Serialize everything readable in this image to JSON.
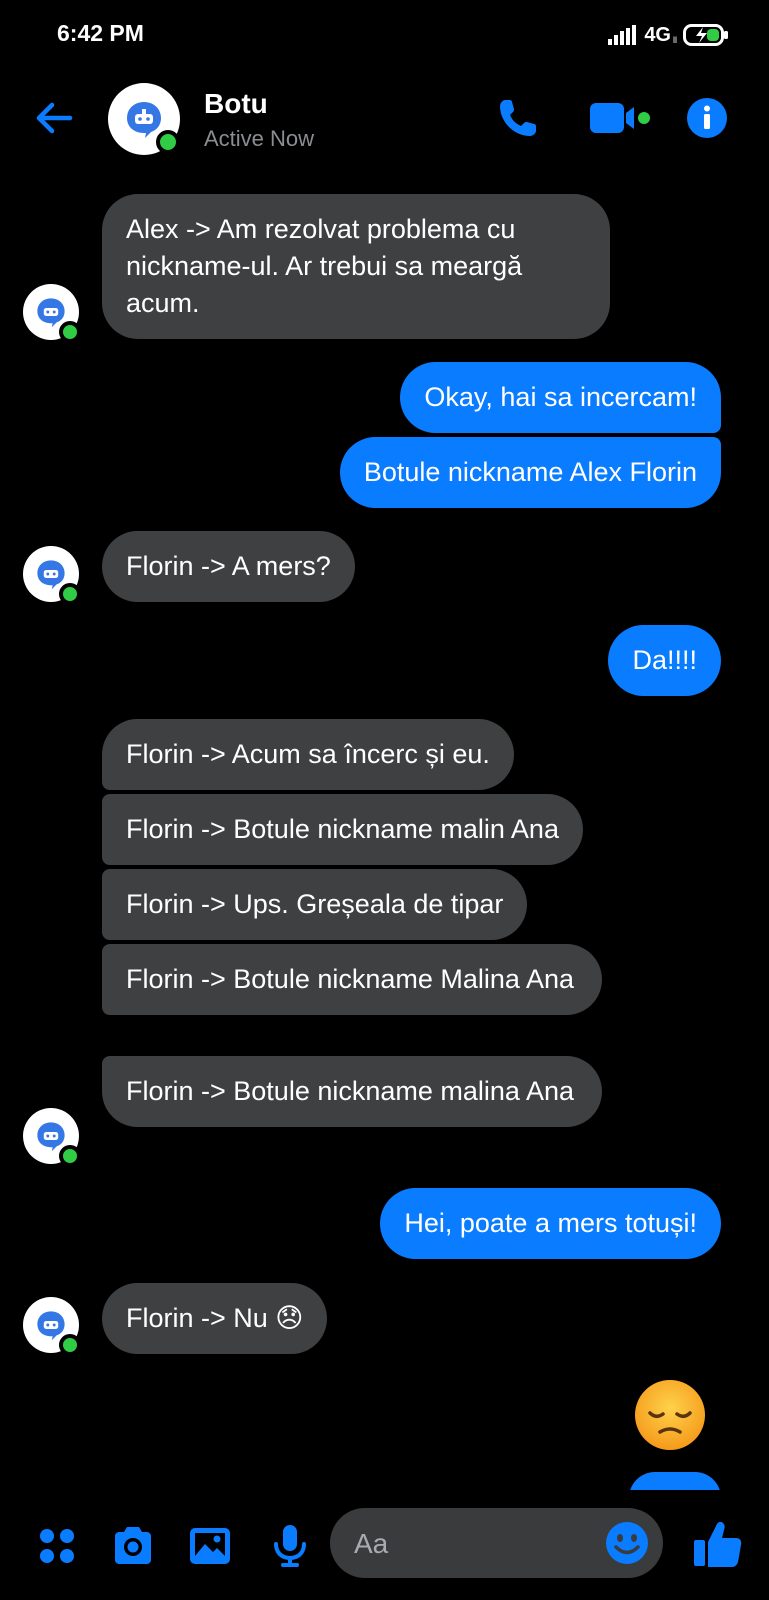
{
  "status_bar": {
    "time": "6:42 PM",
    "network": "4G",
    "network_sub": "ll"
  },
  "header": {
    "name": "Botu",
    "status": "Active Now"
  },
  "messages": [
    {
      "dir": "in",
      "text": "Alex -> Am rezolvat problema cu nickname-ul. Ar trebui sa meargă acum."
    },
    {
      "dir": "out",
      "text": "Okay, hai sa incercam!"
    },
    {
      "dir": "out",
      "text": "Botule nickname Alex Florin"
    },
    {
      "dir": "in",
      "text": "Florin -> A mers?"
    },
    {
      "dir": "out",
      "text": "Da!!!!"
    },
    {
      "dir": "in",
      "text": "Florin -> Acum sa încerc și eu."
    },
    {
      "dir": "in",
      "text": "Florin -> Botule nickname malin Ana"
    },
    {
      "dir": "in",
      "text": "Florin -> Ups. Greșeala de tipar"
    },
    {
      "dir": "in",
      "text": "Florin -> Botule nickname Malina Ana"
    },
    {
      "dir": "in",
      "text": "Florin -> Botule nickname malina Ana"
    },
    {
      "dir": "out",
      "text": "Hei, poate a mers totuși!"
    },
    {
      "dir": "in",
      "text": "Florin -> Nu 😞"
    },
    {
      "dir": "out",
      "text": "😞",
      "emoji_only": true
    }
  ],
  "composer": {
    "placeholder": "Aa"
  },
  "icons": {
    "back": "back-arrow-icon",
    "call": "phone-icon",
    "video": "video-camera-icon",
    "info": "info-icon",
    "apps": "apps-grid-icon",
    "camera": "camera-icon",
    "gallery": "gallery-icon",
    "mic": "microphone-icon",
    "emoji": "emoji-icon",
    "like": "thumbs-up-icon",
    "bot": "bot-avatar-icon"
  },
  "colors": {
    "accent": "#0a7cff",
    "incoming_bubble": "#3e4042",
    "online": "#31cc46",
    "background": "#000000"
  }
}
